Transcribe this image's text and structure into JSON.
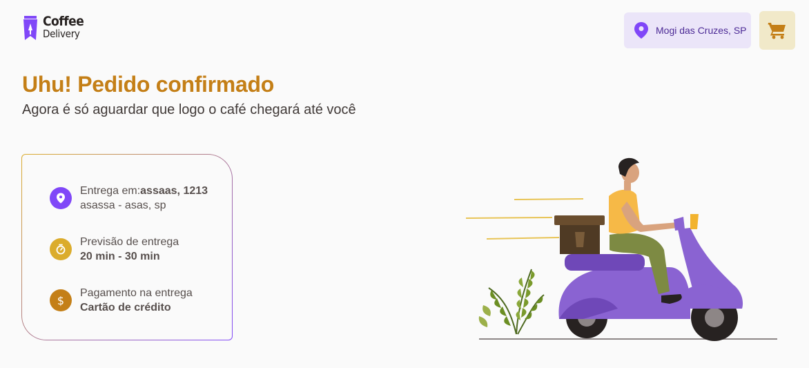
{
  "header": {
    "logo": {
      "line1": "Coffee",
      "line2": "Delivery"
    },
    "location": "Mogi das Cruzes, SP",
    "colors": {
      "location_bg": "#ebe5f9",
      "cart_bg": "#f1e9c9",
      "cart_icon": "#c47f17"
    }
  },
  "main": {
    "title": "Uhu! Pedido confirmado",
    "subtitle": "Agora é só aguardar que logo o café chegará até você"
  },
  "order_info": {
    "address": {
      "icon": "map-pin-icon",
      "prefix": "Entrega em:",
      "street": "assaas, 1213",
      "detail": "asassa - asas, sp"
    },
    "delivery_time": {
      "icon": "timer-icon",
      "label": "Previsão de entrega",
      "value": "20 min - 30 min"
    },
    "payment": {
      "icon": "dollar-icon",
      "symbol": "$",
      "label": "Pagamento na entrega",
      "value": "Cartão de crédito"
    },
    "colors": {
      "purple": "#8047f8",
      "yellow": "#dbac2c",
      "yellow_dark": "#c47f17"
    }
  },
  "illustration": {
    "icon": "delivery-scooter-illustration"
  }
}
